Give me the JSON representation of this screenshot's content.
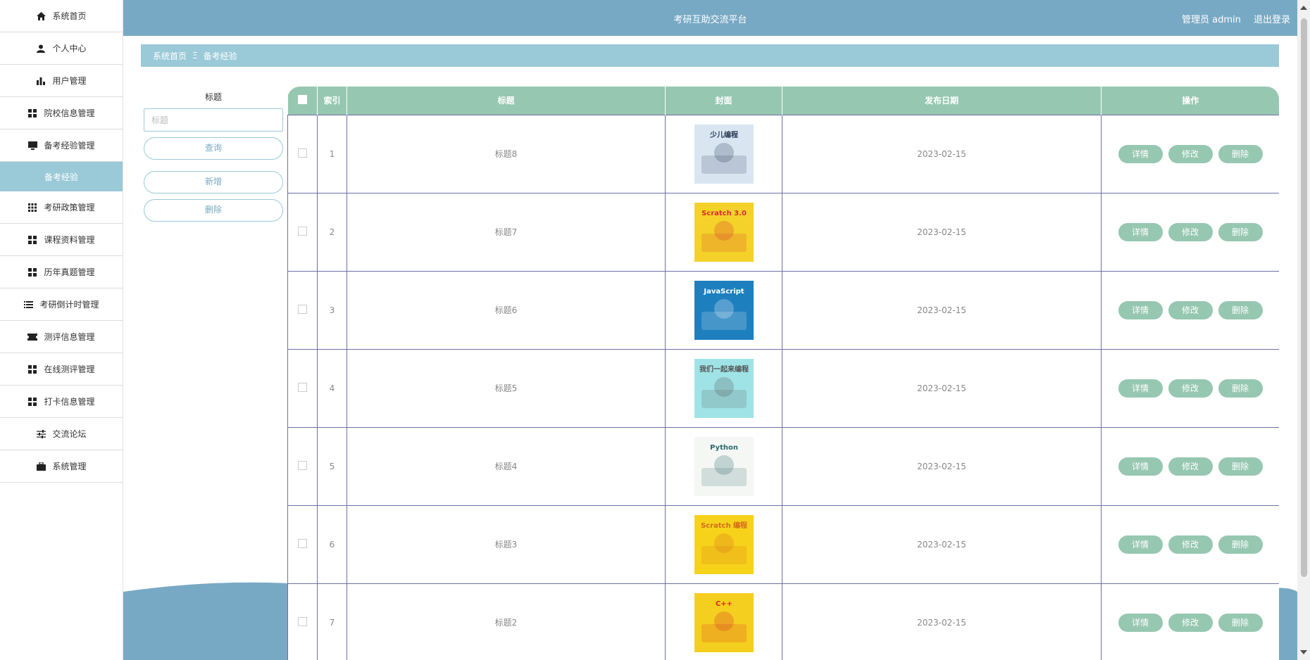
{
  "header": {
    "title": "考研互助交流平台",
    "role": "管理员 admin",
    "logout": "退出登录"
  },
  "sidebar": {
    "items": [
      {
        "label": "系统首页",
        "icon": "home-icon"
      },
      {
        "label": "个人中心",
        "icon": "user-icon"
      },
      {
        "label": "用户管理",
        "icon": "bar-chart-icon"
      },
      {
        "label": "院校信息管理",
        "icon": "grid-icon"
      },
      {
        "label": "备考经验管理",
        "icon": "monitor-icon"
      },
      {
        "label": "备考经验",
        "sub": true
      },
      {
        "label": "考研政策管理",
        "icon": "apps-icon"
      },
      {
        "label": "课程资料管理",
        "icon": "grid-icon"
      },
      {
        "label": "历年真题管理",
        "icon": "grid-icon"
      },
      {
        "label": "考研倒计时管理",
        "icon": "list-icon"
      },
      {
        "label": "测评信息管理",
        "icon": "ticket-icon"
      },
      {
        "label": "在线测评管理",
        "icon": "grid-icon"
      },
      {
        "label": "打卡信息管理",
        "icon": "grid-icon"
      },
      {
        "label": "交流论坛",
        "icon": "sliders-icon"
      },
      {
        "label": "系统管理",
        "icon": "briefcase-icon"
      }
    ]
  },
  "breadcrumb": {
    "home": "系统首页",
    "separator": "Ξ",
    "current": "备考经验"
  },
  "search": {
    "label": "标题",
    "placeholder": "标题",
    "query_btn": "查询",
    "add_btn": "新增",
    "delete_btn": "删除"
  },
  "table": {
    "headers": {
      "index": "索引",
      "title": "标题",
      "cover": "封面",
      "date": "发布日期",
      "ops": "操作"
    },
    "rows": [
      {
        "index": "1",
        "title": "标题8",
        "date": "2023-02-15",
        "cover_text": "少儿编程",
        "cover_bg": "#d9e6f2",
        "cover_fg": "#2a3a55"
      },
      {
        "index": "2",
        "title": "标题7",
        "date": "2023-02-15",
        "cover_text": "Scratch 3.0",
        "cover_bg": "#f4d22a",
        "cover_fg": "#d4302b"
      },
      {
        "index": "3",
        "title": "标题6",
        "date": "2023-02-15",
        "cover_text": "JavaScript",
        "cover_bg": "#1e7fbf",
        "cover_fg": "#ffffff"
      },
      {
        "index": "4",
        "title": "标题5",
        "date": "2023-02-15",
        "cover_text": "我们一起来编程",
        "cover_bg": "#9fe3e6",
        "cover_fg": "#555555"
      },
      {
        "index": "5",
        "title": "标题4",
        "date": "2023-02-15",
        "cover_text": "Python",
        "cover_bg": "#f5f7f5",
        "cover_fg": "#2b6a6b"
      },
      {
        "index": "6",
        "title": "标题3",
        "date": "2023-02-15",
        "cover_text": "Scratch 编程",
        "cover_bg": "#f7d21a",
        "cover_fg": "#d46a1c"
      },
      {
        "index": "7",
        "title": "标题2",
        "date": "2023-02-15",
        "cover_text": "C++",
        "cover_bg": "#f5cf1f",
        "cover_fg": "#d52626"
      }
    ],
    "op_labels": {
      "detail": "详情",
      "edit": "修改",
      "delete": "删除"
    }
  },
  "colors": {
    "header": "#78a9c4",
    "accent_light": "#9ac9d8",
    "table_head": "#96c7b1",
    "row_border": "#6d6fa6"
  }
}
